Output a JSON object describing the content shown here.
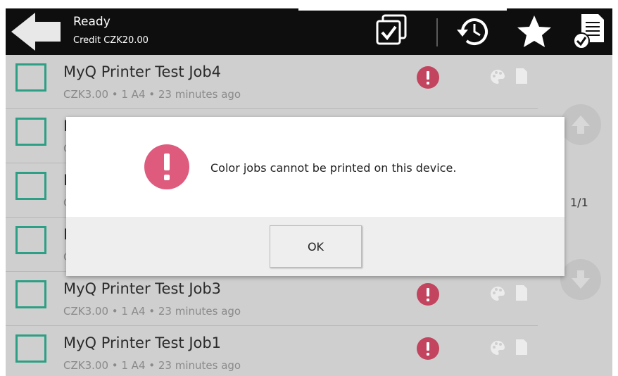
{
  "status": {
    "title": "Ready",
    "credit": "Credit CZK20.00"
  },
  "toolbar": {
    "icons": [
      "back-arrow-icon",
      "select-all-icon",
      "history-icon",
      "favorites-star-icon",
      "print-all-icon"
    ]
  },
  "jobs": [
    {
      "title": "MyQ Printer Test Job4",
      "meta": "CZK3.00 • 1 A4 • 23 minutes ago"
    },
    {
      "title": "M",
      "meta": "C"
    },
    {
      "title": "M",
      "meta": "C"
    },
    {
      "title": "M",
      "meta": "C"
    },
    {
      "title": "MyQ Printer Test Job3",
      "meta": "CZK3.00 • 1 A4 • 23 minutes ago"
    },
    {
      "title": "MyQ Printer Test Job1",
      "meta": "CZK3.00 • 1 A4 • 23 minutes ago"
    }
  ],
  "pager": {
    "text": "1/1"
  },
  "dialog": {
    "message": "Color jobs cannot be printed on this device.",
    "ok_label": "OK"
  },
  "colors": {
    "accent_checkbox": "#2c9f84",
    "alert": "#c2445e",
    "dialog_alert": "#de5b7d",
    "topbar": "#0e0e0e"
  }
}
